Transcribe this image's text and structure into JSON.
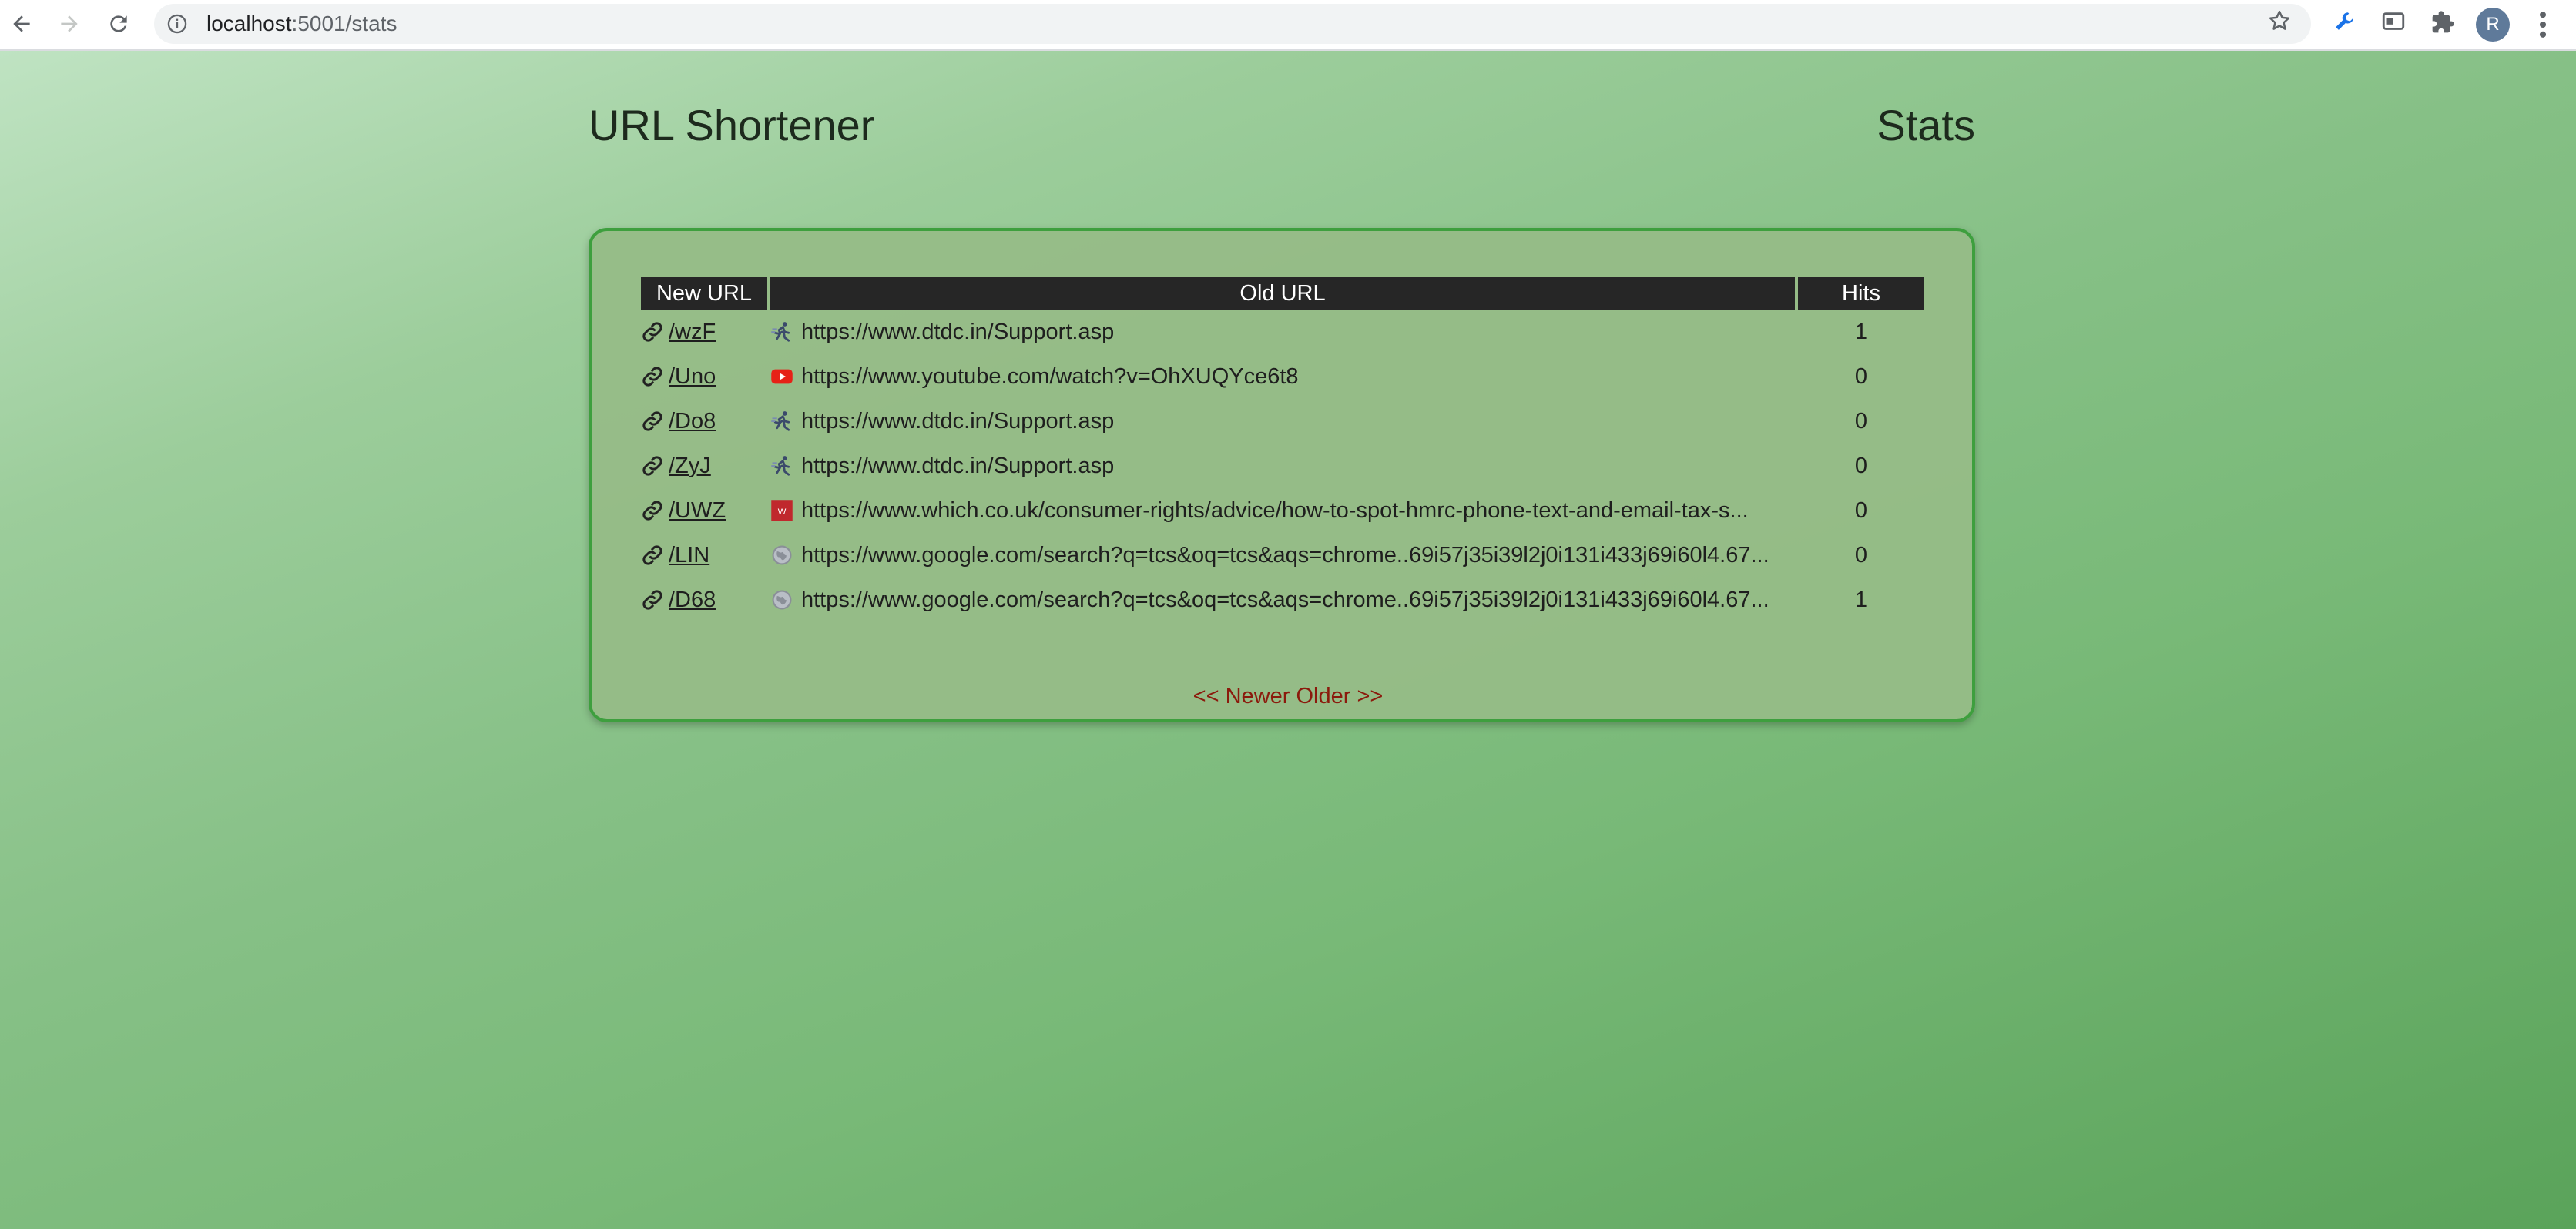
{
  "browser": {
    "url_host": "localhost",
    "url_path": ":5001/stats",
    "avatar_letter": "R"
  },
  "header": {
    "title": "URL Shortener",
    "stats_link": "Stats"
  },
  "table": {
    "columns": [
      "New URL",
      "Old URL",
      "Hits"
    ],
    "rows": [
      {
        "short": "/wzF",
        "old": "https://www.dtdc.in/Support.asp",
        "hits": "1",
        "favicon": "dtdc-runner-icon"
      },
      {
        "short": "/Uno",
        "old": "https://www.youtube.com/watch?v=OhXUQYce6t8",
        "hits": "0",
        "favicon": "youtube-icon"
      },
      {
        "short": "/Do8",
        "old": "https://www.dtdc.in/Support.asp",
        "hits": "0",
        "favicon": "dtdc-runner-icon"
      },
      {
        "short": "/ZyJ",
        "old": "https://www.dtdc.in/Support.asp",
        "hits": "0",
        "favicon": "dtdc-runner-icon"
      },
      {
        "short": "/UWZ",
        "old": "https://www.which.co.uk/consumer-rights/advice/how-to-spot-hmrc-phone-text-and-email-tax-s...",
        "hits": "0",
        "favicon": "which-icon"
      },
      {
        "short": "/LIN",
        "old": "https://www.google.com/search?q=tcs&oq=tcs&aqs=chrome..69i57j35i39l2j0i131i433j69i60l4.67...",
        "hits": "0",
        "favicon": "globe-icon"
      },
      {
        "short": "/D68",
        "old": "https://www.google.com/search?q=tcs&oq=tcs&aqs=chrome..69i57j35i39l2j0i131i433j69i60l4.67...",
        "hits": "1",
        "favicon": "globe-icon"
      }
    ]
  },
  "pager": {
    "newer": "<< Newer",
    "older": "Older >>"
  },
  "colors": {
    "panel_border": "#3e9f3e",
    "header_bg": "#262626",
    "pager_link": "#8b1a0c"
  }
}
